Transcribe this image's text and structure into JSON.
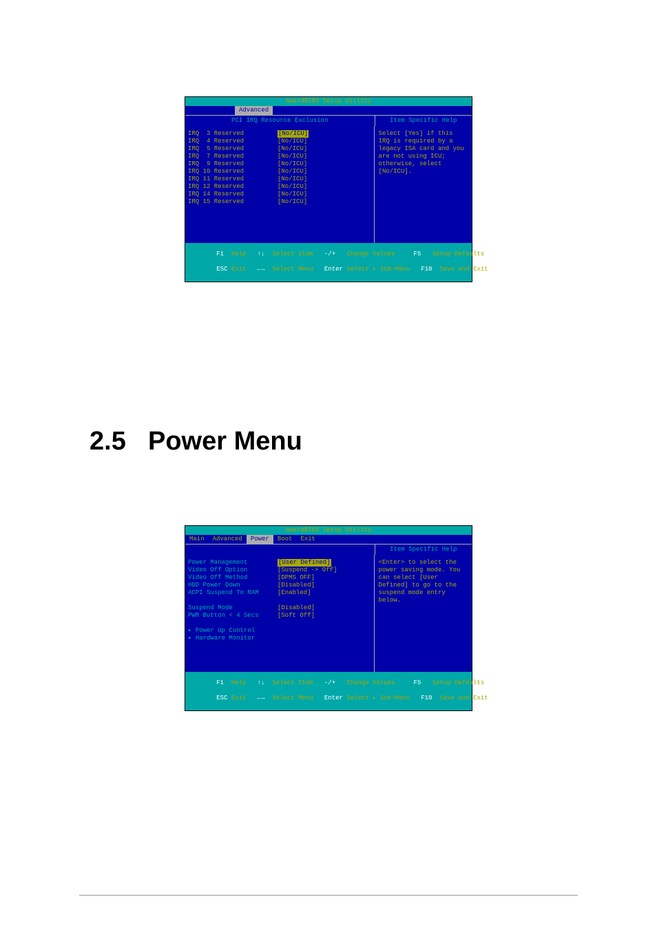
{
  "bios1": {
    "title": "AwardBIOS Setup Utility",
    "tab_active": "Advanced",
    "subheader_left": "PCI IRQ Resource Exclusion",
    "subheader_right": "Item Specific Help",
    "rows": [
      {
        "label": "IRQ  3 Reserved",
        "value": "[No/ICU]",
        "selected": true
      },
      {
        "label": "IRQ  4 Reserved",
        "value": "[No/ICU]"
      },
      {
        "label": "IRQ  5 Reserved",
        "value": "[No/ICU]"
      },
      {
        "label": "IRQ  7 Reserved",
        "value": "[No/ICU]"
      },
      {
        "label": "IRQ  9 Reserved",
        "value": "[No/ICU]"
      },
      {
        "label": "IRQ 10 Reserved",
        "value": "[No/ICU]"
      },
      {
        "label": "IRQ 11 Reserved",
        "value": "[No/ICU]"
      },
      {
        "label": "IRQ 12 Reserved",
        "value": "[No/ICU]"
      },
      {
        "label": "IRQ 14 Reserved",
        "value": "[No/ICU]"
      },
      {
        "label": "IRQ 15 Reserved",
        "value": "[No/ICU]"
      }
    ],
    "help": "Select [Yes] if this IRQ is required by a legacy ISA card and you are not using ICU; otherwise, select [No/ICU].",
    "footer": {
      "f1": "F1",
      "help": "Help",
      "ud": "↑↓",
      "select_item": "Select Item",
      "pm": "-/+",
      "change_values": "Change Values",
      "f5": "F5",
      "setup_defaults": "Setup Defaults",
      "esc": "ESC",
      "exit": "Exit",
      "lr": "←→",
      "select_menu": "Select Menu",
      "enter": "Enter",
      "select_sub": "Select ▸ Sub-Menu",
      "f10": "F10",
      "save_exit": "Save and Exit"
    }
  },
  "heading": {
    "num": "2.5",
    "text": "Power Menu"
  },
  "bios2": {
    "title": "AwardBIOS Setup Utility",
    "tabs": [
      "Main",
      "Advanced",
      "Power",
      "Boot",
      "Exit"
    ],
    "tab_active": "Power",
    "subheader_right": "Item Specific Help",
    "rows": [
      {
        "label": "Power Management",
        "value": "[User Defined]",
        "selected": true,
        "cyan": true
      },
      {
        "label": "Video Off Option",
        "value": "[Suspend -> Off]",
        "cyan": true
      },
      {
        "label": "Video Off Method",
        "value": "[DPMS OFF]",
        "cyan": true
      },
      {
        "label": "HDD Power Down",
        "value": "[Disabled]",
        "cyan": true
      },
      {
        "label": "ACPI Suspend To RAM",
        "value": "[Enabled]",
        "cyan": true
      },
      {
        "blank": true
      },
      {
        "label": "Suspend Mode",
        "value": "[Disabled]",
        "cyan": true
      },
      {
        "label": "PWR Button < 4 Secs",
        "value": "[Soft Off]",
        "cyan": true
      },
      {
        "blank": true
      },
      {
        "sub": "▸ Power Up Control"
      },
      {
        "sub": "▸ Hardware Monitor"
      }
    ],
    "help": "<Enter> to select the power saving mode. You can select [User Defined] to go to the suspend mode entry below.",
    "footer": {
      "f1": "F1",
      "help": "Help",
      "ud": "↑↓",
      "select_item": "Select Item",
      "pm": "-/+",
      "change_values": "Change Values",
      "f5": "F5",
      "setup_defaults": "Setup Defaults",
      "esc": "ESC",
      "exit": "Exit",
      "lr": "←→",
      "select_menu": "Select Menu",
      "enter": "Enter",
      "select_sub": "Select ▸ Sub-Menu",
      "f10": "F10",
      "save_exit": "Save and Exit"
    }
  }
}
